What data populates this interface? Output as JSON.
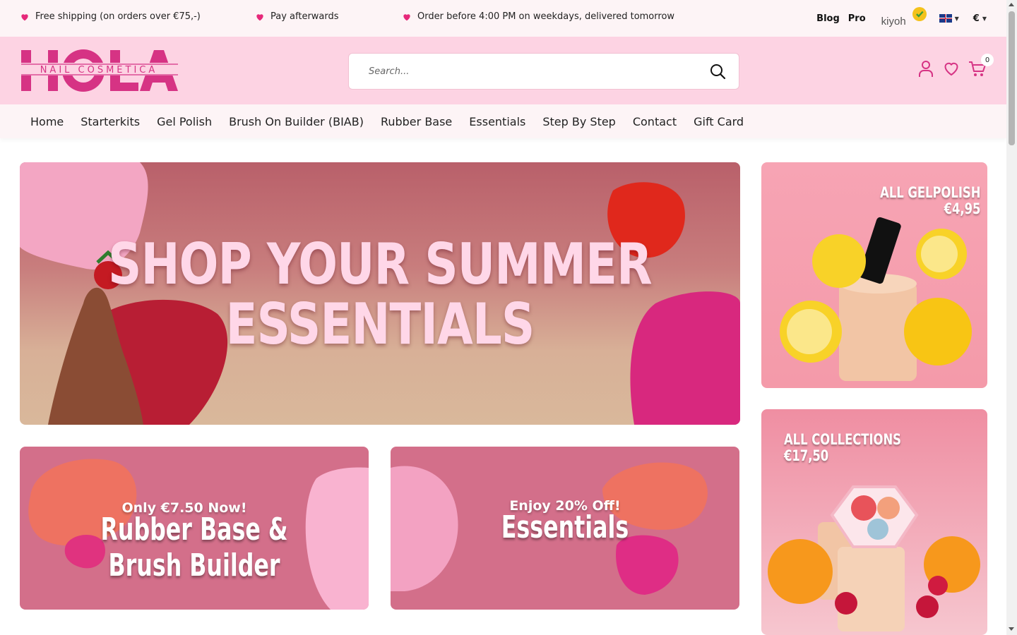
{
  "usp": [
    {
      "text": "Free shipping (on orders over €75,-)"
    },
    {
      "text": "Pay afterwards"
    },
    {
      "text": "Order before 4:00 PM on weekdays, delivered tomorrow"
    }
  ],
  "top_links": {
    "blog": "Blog",
    "pro": "Pro",
    "kiyoh": "kiyoh",
    "currency": "€"
  },
  "logo": {
    "main": "HOLA",
    "sub": "NAIL COSMETICA"
  },
  "search": {
    "placeholder": "Search..."
  },
  "cart": {
    "count": "0"
  },
  "nav": [
    "Home",
    "Starterkits",
    "Gel Polish",
    "Brush On Builder (BIAB)",
    "Rubber Base",
    "Essentials",
    "Step By Step",
    "Contact",
    "Gift Card"
  ],
  "hero": {
    "line1": "SHOP YOUR SUMMER",
    "line2": "ESSENTIALS"
  },
  "side_banners": [
    {
      "line1": "ALL GELPOLISH",
      "line2": "€4,95"
    },
    {
      "line1": "ALL COLLECTIONS",
      "line2": "€17,50"
    }
  ],
  "promo_banners": [
    {
      "sub": "Only €7.50 Now!",
      "big": "Rubber Base & Brush Builder"
    },
    {
      "sub": "Enjoy 20% Off!",
      "big": "Essentials"
    }
  ],
  "colors": {
    "brand_pink": "#d63384",
    "header_bg": "#fdd3e3",
    "heart": "#e6287a"
  }
}
